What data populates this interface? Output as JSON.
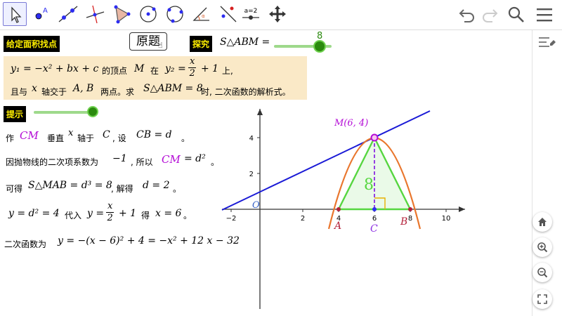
{
  "toolbar": {
    "tools": [
      {
        "name": "move-tool-icon",
        "selected": true
      },
      {
        "name": "point-tool-icon",
        "selected": false
      },
      {
        "name": "line-tool-icon",
        "selected": false
      },
      {
        "name": "perpendicular-line-tool-icon",
        "selected": false
      },
      {
        "name": "polygon-tool-icon",
        "selected": false
      },
      {
        "name": "circle-center-point-tool-icon",
        "selected": false
      },
      {
        "name": "circle-three-points-tool-icon",
        "selected": false
      },
      {
        "name": "angle-tool-icon",
        "selected": false
      },
      {
        "name": "reflect-tool-icon",
        "selected": false
      },
      {
        "name": "slider-tool-icon",
        "selected": false
      },
      {
        "name": "move-graphics-view-tool-icon",
        "selected": false
      }
    ],
    "slider_tool_text": "a=2"
  },
  "header": {
    "title_label": "给定面积找点",
    "original_button": "原题",
    "explore_label": "探究",
    "area_label": "S△ABM =",
    "area_slider_value": "8"
  },
  "problem": {
    "line1_eq1": "y₁ = −x² + bx + c",
    "line1_vertex": "的顶点",
    "line1_M": "M",
    "line1_on": "在",
    "line1_eq2_left": "y₂ =",
    "line1_eq2_num": "x",
    "line1_eq2_den": "2",
    "line1_eq2_right": "+ 1",
    "line1_end": "上,",
    "line2_a": "且与",
    "line2_x": "x",
    "line2_b": "轴交于",
    "line2_AB": "A, B",
    "line2_c": "两点。求",
    "line2_S": "S△ABM = 8",
    "line2_d": "时, 二次函数的解析式。"
  },
  "hint": {
    "label": "提示"
  },
  "solution": {
    "s1_a": "作",
    "s1_CM": "CM",
    "s1_b": "垂直",
    "s1_x": "x",
    "s1_c": "轴于",
    "s1_C": "C",
    "s1_d": ", 设",
    "s1_eq": "CB = d",
    "s1_e": "。",
    "s2_a": "因抛物线的二次项系数为",
    "s2_val": "−1",
    "s2_b": ", 所以",
    "s2_CM": "CM",
    "s2_eq": "= d²",
    "s2_c": "。",
    "s3_a": "可得",
    "s3_eq": "S△MAB = d³ = 8",
    "s3_b": ", 解得",
    "s3_eq2": "d = 2",
    "s3_c": "。",
    "s4_eq": "y = d² = 4",
    "s4_a": "代入",
    "s4_eq2_left": "y =",
    "s4_eq2_num": "x",
    "s4_eq2_den": "2",
    "s4_eq2_right": "+ 1",
    "s4_b": "得",
    "s4_eq3": "x = 6",
    "s4_c": "。",
    "s5_a": "二次函数为",
    "s5_eq": "y = −(x − 6)² + 4 = −x² + 12 x − 32"
  },
  "graph": {
    "point_M_label": "M(6, 4)",
    "point_A": "A",
    "point_B": "B",
    "point_C": "C",
    "origin": "O",
    "area_text": "8",
    "x_ticks": [
      "−2",
      "2",
      "4",
      "6",
      "8",
      "10"
    ],
    "y_ticks": [
      "2",
      "4"
    ],
    "colors": {
      "line": "#1a1ad6",
      "parabola": "#e9762d",
      "triangle": "#56d640",
      "purple": "#b40cd6",
      "altitude": "#8a2be2"
    }
  },
  "side": {
    "home": "home-icon",
    "zoom_in": "zoom-in-icon",
    "zoom_out": "zoom-out-icon",
    "fullscreen": "fullscreen-icon"
  }
}
